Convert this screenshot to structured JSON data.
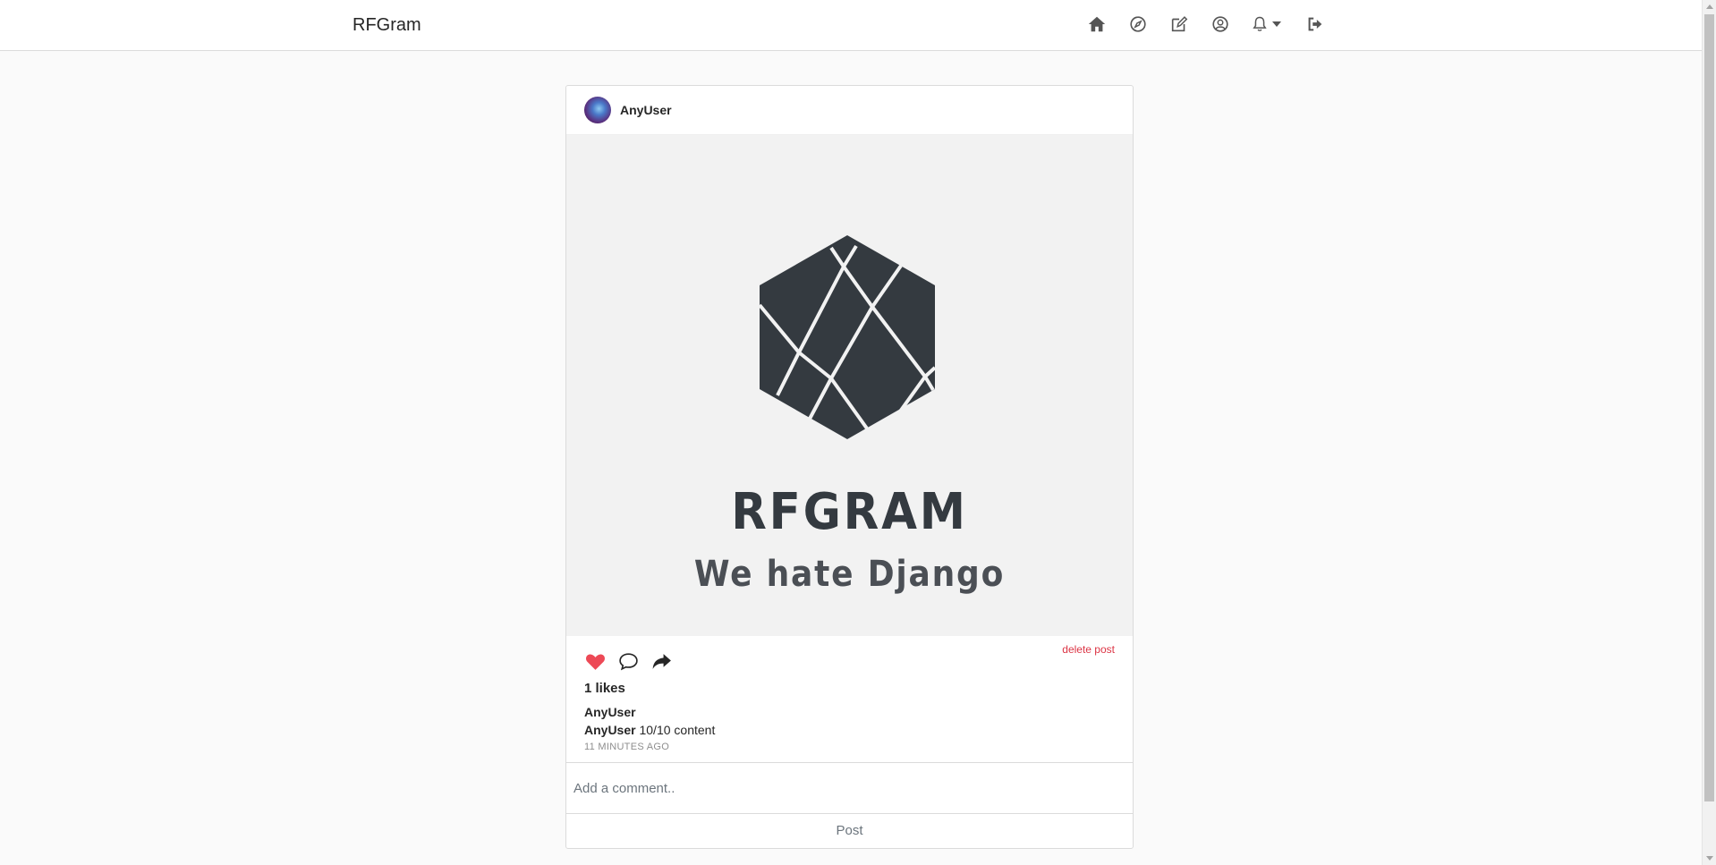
{
  "nav": {
    "brand": "RFGram",
    "icons": [
      "home-icon",
      "explore-compass-icon",
      "new-post-edit-icon",
      "profile-icon",
      "notifications-bell-icon",
      "logout-icon"
    ]
  },
  "post": {
    "author": "AnyUser",
    "image": {
      "title": "RFGRAM",
      "subtitle": "We hate Django"
    },
    "delete_label": "delete post",
    "liked": true,
    "likes_text": "1 likes",
    "caption_user": "AnyUser",
    "comments": [
      {
        "user": "AnyUser",
        "text": "10/10 content"
      }
    ],
    "timestamp": "11 MINUTES AGO",
    "comment_placeholder": "Add a comment..",
    "post_button": "Post"
  },
  "colors": {
    "like": "#ed4956",
    "delete": "#dc3545",
    "logo": "#343a40"
  }
}
